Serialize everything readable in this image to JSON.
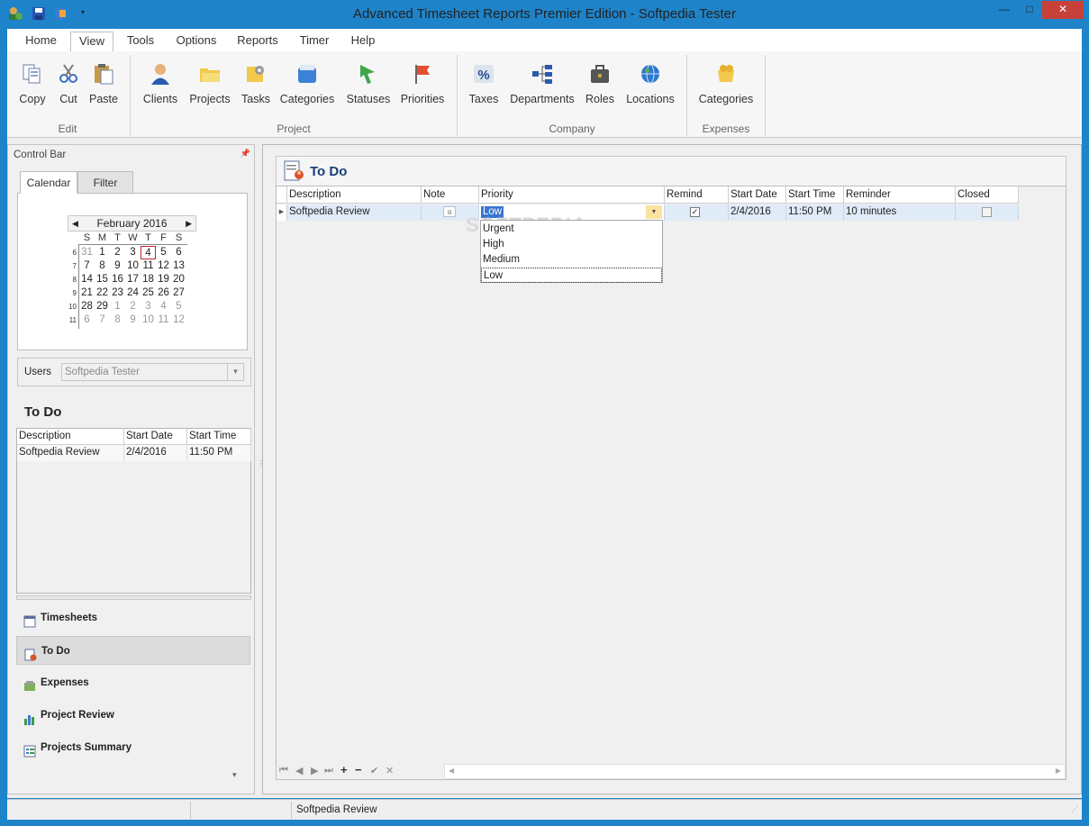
{
  "window": {
    "title": "Advanced Timesheet Reports Premier Edition - Softpedia Tester",
    "minimize": "—",
    "maximize": "□",
    "close": "✕"
  },
  "menu": {
    "tabs": [
      "Home",
      "View",
      "Tools",
      "Options",
      "Reports",
      "Timer",
      "Help"
    ],
    "active": "View"
  },
  "ribbon": {
    "edit": {
      "label": "Edit",
      "copy": "Copy",
      "cut": "Cut",
      "paste": "Paste"
    },
    "project": {
      "label": "Project",
      "clients": "Clients",
      "projects": "Projects",
      "tasks": "Tasks",
      "categories": "Categories",
      "statuses": "Statuses",
      "priorities": "Priorities"
    },
    "company": {
      "label": "Company",
      "taxes": "Taxes",
      "departments": "Departments",
      "roles": "Roles",
      "locations": "Locations"
    },
    "expenses": {
      "label": "Expenses",
      "categories": "Categories"
    }
  },
  "control_bar": {
    "title": "Control Bar",
    "pin": "📌",
    "tabs": {
      "calendar": "Calendar",
      "filter": "Filter"
    },
    "calendar": {
      "month": "February 2016",
      "prev": "◀",
      "next": "▶",
      "dow": [
        "S",
        "M",
        "T",
        "W",
        "T",
        "F",
        "S"
      ],
      "weeks": [
        "6",
        "7",
        "8",
        "9",
        "10",
        "11"
      ],
      "days": [
        [
          "31",
          "1",
          "2",
          "3",
          "4",
          "5",
          "6"
        ],
        [
          "7",
          "8",
          "9",
          "10",
          "11",
          "12",
          "13"
        ],
        [
          "14",
          "15",
          "16",
          "17",
          "18",
          "19",
          "20"
        ],
        [
          "21",
          "22",
          "23",
          "24",
          "25",
          "26",
          "27"
        ],
        [
          "28",
          "29",
          "1",
          "2",
          "3",
          "4",
          "5"
        ],
        [
          "6",
          "7",
          "8",
          "9",
          "10",
          "11",
          "12"
        ]
      ],
      "today": "4"
    },
    "users": {
      "label": "Users",
      "value": "Softpedia Tester"
    },
    "todo": {
      "title": "To Do",
      "columns": [
        "Description",
        "Start Date",
        "Start Time"
      ],
      "rows": [
        [
          "Softpedia Review",
          "2/4/2016",
          "11:50 PM"
        ]
      ]
    },
    "nav": {
      "timesheets": "Timesheets",
      "todo": "To Do",
      "expenses": "Expenses",
      "project_review": "Project Review",
      "projects_summary": "Projects Summary"
    },
    "more": "▾"
  },
  "main": {
    "title": "To Do",
    "columns": [
      "Description",
      "Note",
      "Priority",
      "Remind",
      "Start Date",
      "Start Time",
      "Reminder",
      "Closed"
    ],
    "row": {
      "description": "Softpedia Review",
      "note": "a",
      "priority": "Low",
      "remind": true,
      "start_date": "2/4/2016",
      "start_time": "11:50 PM",
      "reminder": "10 minutes",
      "closed": false
    },
    "priority_options": [
      "Urgent",
      "High",
      "Medium",
      "Low"
    ],
    "priority_selected": "Low",
    "navigator": {
      "first": "⏮",
      "prev": "◀",
      "next": "▶",
      "last": "⏭",
      "add": "+",
      "remove": "−",
      "save": "✔",
      "cancel": "✕"
    }
  },
  "status": {
    "text": "Softpedia Review"
  },
  "watermark": "SOFTPEDIA",
  "colors": {
    "titlebar": "#1e83c9",
    "accent": "#1a3d7c",
    "selected_row": "#e0ebf8"
  }
}
